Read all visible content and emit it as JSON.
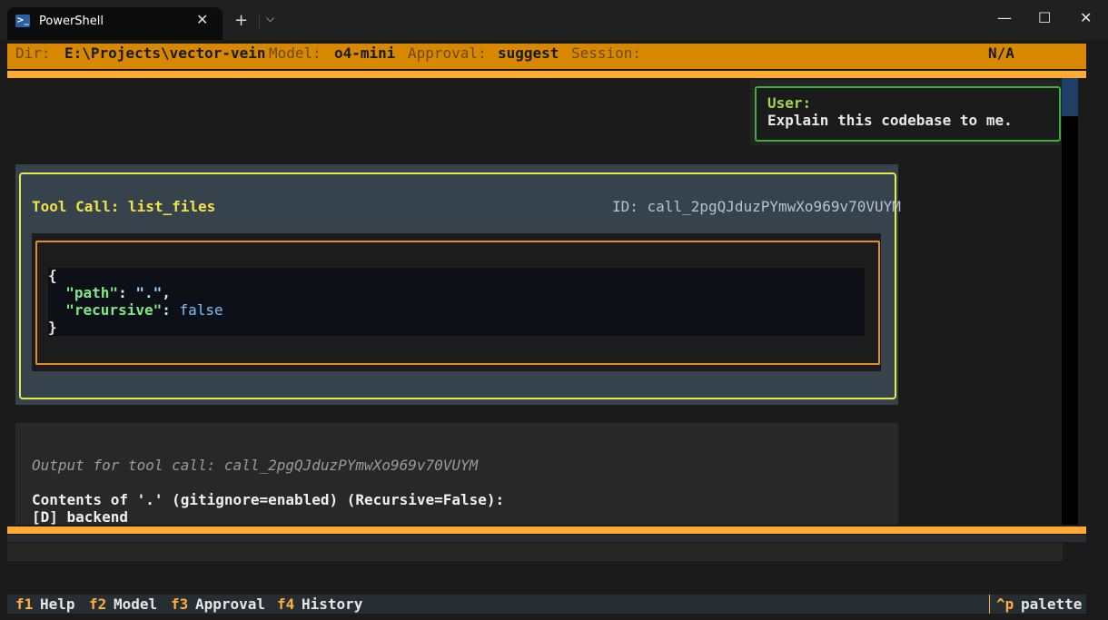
{
  "window": {
    "tab_title": "PowerShell",
    "tab_icon": "powershell-icon",
    "close_tab": "✕",
    "new_tab": "+",
    "dropdown": "⌵",
    "minimize": "—",
    "maximize": "☐",
    "close": "✕"
  },
  "status": {
    "dir_key": "Dir:",
    "dir_val": "E:\\Projects\\vector-vein",
    "model_key": "Model:",
    "model_val": "o4-mini",
    "approval_key": "Approval:",
    "approval_val": "suggest",
    "session_key": "Session:",
    "session_val": "N/A"
  },
  "user_message": {
    "label": "User:",
    "text": "Explain this codebase to me."
  },
  "tool_call": {
    "title": "Tool Call: list_files",
    "id": "ID: call_2pgQJduzPYmwXo969v70VUYM",
    "code": {
      "open": "{",
      "line1_key": "\"path\"",
      "line1_sep": ": ",
      "line1_val": "\".\"",
      "line1_end": ",",
      "line2_key": "\"recursive\"",
      "line2_sep": ": ",
      "line2_val": "false",
      "close": "}"
    }
  },
  "tool_output": {
    "header": "Output for tool call: call_2pgQJduzPYmwXo969v70VUYM",
    "lines": [
      "Contents of '.' (gitignore=enabled) (Recursive=False):",
      "[D] backend"
    ]
  },
  "footer": {
    "items": [
      {
        "key": "f1",
        "label": "Help"
      },
      {
        "key": "f2",
        "label": "Model"
      },
      {
        "key": "f3",
        "label": "Approval"
      },
      {
        "key": "f4",
        "label": "History"
      }
    ],
    "palette_key": "^p",
    "palette_label": "palette"
  },
  "colors": {
    "status_bar": "#d78700",
    "accent_line": "#ffaa33",
    "user_border": "#3fae3f",
    "tool_border": "#e8e84a",
    "args_border": "#e58a2b"
  }
}
